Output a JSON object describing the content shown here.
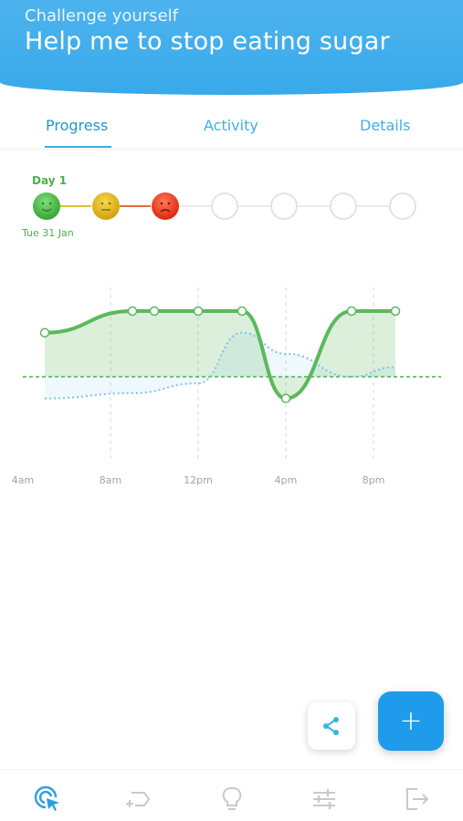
{
  "header": {
    "subtitle": "Challenge yourself",
    "title": "Help me to stop eating sugar",
    "color": "#38a9ea"
  },
  "tabs": [
    {
      "label": "Progress",
      "active": true
    },
    {
      "label": "Activity",
      "active": false
    },
    {
      "label": "Details",
      "active": false
    }
  ],
  "timeline": {
    "day_label": "Day 1",
    "date_label": "Tue 31 Jan",
    "moods": [
      "happy",
      "neutral",
      "sad",
      "empty",
      "empty",
      "empty",
      "empty"
    ]
  },
  "chart_data": {
    "type": "line",
    "x_ticks": [
      "4am",
      "8am",
      "12pm",
      "4pm",
      "8pm"
    ],
    "series": [
      {
        "style": "solid",
        "color": "#5cb85c",
        "fill": true,
        "points": [
          {
            "x": 5,
            "y": 0.67
          },
          {
            "x": 9,
            "y": 1.0
          },
          {
            "x": 10,
            "y": 1.0
          },
          {
            "x": 12,
            "y": 1.0
          },
          {
            "x": 14,
            "y": 1.0
          },
          {
            "x": 16,
            "y": -0.33
          },
          {
            "x": 19,
            "y": 1.0
          },
          {
            "x": 21,
            "y": 1.0
          }
        ]
      },
      {
        "style": "dotted",
        "color": "#7cc4ea",
        "fill": true,
        "points": [
          {
            "x": 5,
            "y": -0.33
          },
          {
            "x": 9,
            "y": -0.25
          },
          {
            "x": 12,
            "y": -0.1
          },
          {
            "x": 14,
            "y": 0.67
          },
          {
            "x": 16,
            "y": 0.35
          },
          {
            "x": 19,
            "y": 0.0
          },
          {
            "x": 21,
            "y": 0.15
          }
        ]
      }
    ],
    "baseline": 0,
    "baseline_color": "#4caf50",
    "grid": "vertical dashed"
  },
  "actions": {
    "share_icon": "share-icon",
    "add_label": "+"
  },
  "bottom_nav": [
    {
      "icon": "tap-target-icon",
      "active": true
    },
    {
      "icon": "add-goal-icon",
      "active": false
    },
    {
      "icon": "lightbulb-icon",
      "active": false
    },
    {
      "icon": "sliders-icon",
      "active": false
    },
    {
      "icon": "logout-icon",
      "active": false
    }
  ]
}
